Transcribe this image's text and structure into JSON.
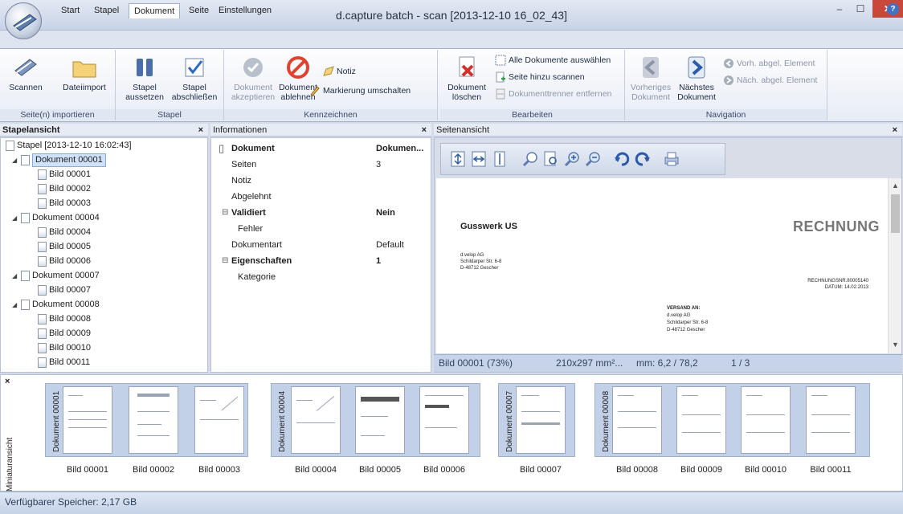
{
  "window": {
    "title": "d.capture batch - scan [2013-12-10 16_02_43]",
    "min": "–",
    "max": "☐",
    "close": "✕"
  },
  "tabs": [
    {
      "label": "Start"
    },
    {
      "label": "Stapel"
    },
    {
      "label": "Dokument",
      "active": true
    },
    {
      "label": "Seite"
    },
    {
      "label": "Einstellungen"
    }
  ],
  "help": "?",
  "ribbon": {
    "import": {
      "scan": "Scannen",
      "fileimport": "Dateiimport",
      "group": "Seite(n) importieren"
    },
    "stapel": {
      "suspend1": "Stapel",
      "suspend2": "aussetzen",
      "close1": "Stapel",
      "close2": "abschließen",
      "group": "Stapel"
    },
    "kennz": {
      "accept1": "Dokument",
      "accept2": "akzeptieren",
      "reject1": "Dokument",
      "reject2": "ablehnen",
      "note": "Notiz",
      "toggle": "Markierung umschalten",
      "group": "Kennzeichnen"
    },
    "bearbeiten": {
      "delete1": "Dokument",
      "delete2": "löschen",
      "selectall": "Alle Dokumente auswählen",
      "addscan": "Seite hinzu scannen",
      "removesep": "Dokumenttrenner entfernen",
      "group": "Bearbeiten"
    },
    "navigation": {
      "prev1": "Vorheriges",
      "prev2": "Dokument",
      "next1": "Nächstes",
      "next2": "Dokument",
      "prevel": "Vorh. abgel. Element",
      "nextel": "Näch. abgel. Element",
      "group": "Navigation"
    }
  },
  "panels": {
    "stapel": "Stapelansicht",
    "info": "Informationen",
    "seite": "Seitenansicht",
    "close": "×"
  },
  "tree": {
    "root": "Stapel [2013-12-10 16:02:43]",
    "docs": [
      {
        "name": "Dokument 00001",
        "pages": [
          "Bild 00001",
          "Bild 00002",
          "Bild 00003"
        ]
      },
      {
        "name": "Dokument 00004",
        "pages": [
          "Bild 00004",
          "Bild 00005",
          "Bild 00006"
        ]
      },
      {
        "name": "Dokument 00007",
        "pages": [
          "Bild 00007"
        ]
      },
      {
        "name": "Dokument 00008",
        "pages": [
          "Bild 00008",
          "Bild 00009",
          "Bild 00010",
          "Bild 00011"
        ]
      }
    ]
  },
  "info": {
    "header_key": "Dokument",
    "header_val": "Dokumen...",
    "seiten": "Seiten",
    "seiten_val": "3",
    "notiz": "Notiz",
    "abgelehnt": "Abgelehnt",
    "validiert": "Validiert",
    "validiert_val": "Nein",
    "fehler": "Fehler",
    "dokumentart": "Dokumentart",
    "dokumentart_val": "Default",
    "eigenschaften": "Eigenschaften",
    "eigenschaften_val": "1",
    "kategorie": "Kategorie",
    "minus": "⊟"
  },
  "document": {
    "company": "Gusswerk US",
    "heading": "RECHNUNG",
    "sender1": "d.velop AG",
    "sender2": "Schildarper Str. 6-8",
    "sender3": "D-48712 Gescher",
    "invno": "RECHNUNGSNR.80005140",
    "date": "DATUM: 14.02.2013",
    "ship_head": "VERSAND AN:",
    "ship1": "d.velop AG",
    "ship2": "Schildarper Str. 6-8",
    "ship3": "D-48712 Gescher"
  },
  "viewer_status": {
    "image": "Bild 00001 (73%)",
    "size": "210x297 mm²...",
    "pos": "mm: 6,2 / 78,2",
    "page": "1 / 3"
  },
  "thumbnails": {
    "side_label": "Miniaturansicht",
    "close": "×",
    "groups": [
      {
        "label": "Dokument 00001",
        "pages": [
          "Bild 00001",
          "Bild 00002",
          "Bild 00003"
        ]
      },
      {
        "label": "Dokument 00004",
        "pages": [
          "Bild 00004",
          "Bild 00005",
          "Bild 00006"
        ]
      },
      {
        "label": "Dokument 00007",
        "pages": [
          "Bild 00007"
        ]
      },
      {
        "label": "Dokument 00008",
        "pages": [
          "Bild 00008",
          "Bild 00009",
          "Bild 00010",
          "Bild 00011"
        ]
      }
    ]
  },
  "status": {
    "memory": "Verfügbarer Speicher: 2,17 GB"
  },
  "colors": {
    "accent": "#3f72c7",
    "selection": "#cfe2fa",
    "close": "#c9483c",
    "reject": "#e0422e"
  }
}
